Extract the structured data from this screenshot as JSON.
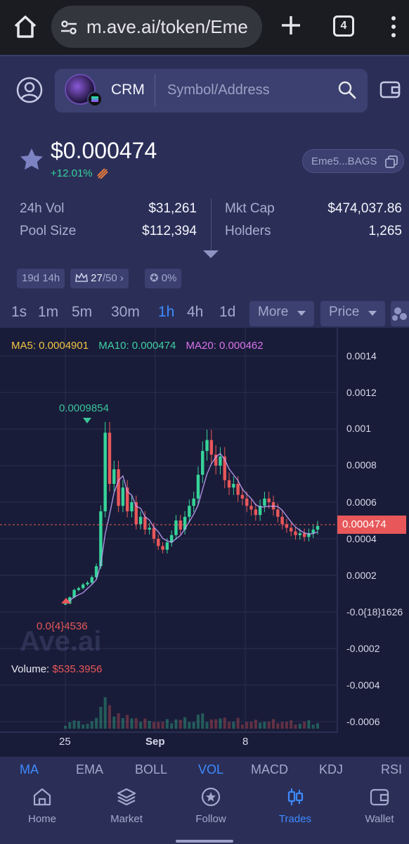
{
  "browser": {
    "url": "m.ave.ai/token/Eme",
    "tab_count": "4",
    "icons": [
      "home-icon",
      "tune-icon",
      "plus-icon",
      "tabs-icon",
      "more-vert-icon"
    ]
  },
  "header": {
    "token_symbol": "CRM",
    "search_placeholder": "Symbol/Address",
    "icons": [
      "user-icon",
      "search-icon",
      "wallet-icon"
    ]
  },
  "token": {
    "price": "$0.000474",
    "change": "+12.01%",
    "address_short": "Eme5...BAGS"
  },
  "stats": {
    "vol_label": "24h Vol",
    "vol_value": "$31,261",
    "pool_label": "Pool Size",
    "pool_value": "$112,394",
    "mcap_label": "Mkt Cap",
    "mcap_value": "$474,037.86",
    "holders_label": "Holders",
    "holders_value": "1,265"
  },
  "chips": {
    "age": "19d 14h",
    "score_num": "27",
    "score_den": "/50",
    "tax": "0%"
  },
  "timeframes": [
    "1s",
    "1m",
    "5m",
    "30m",
    "1h",
    "4h",
    "1d"
  ],
  "active_timeframe": "1h",
  "controls": {
    "more_label": "More",
    "price_label": "Price"
  },
  "chart_data": {
    "type": "candlestick",
    "ma": {
      "ma5": "MA5: 0.0004901",
      "ma10": "MA10: 0.000474",
      "ma20": "MA20: 0.000462"
    },
    "y_ticks": [
      "0.0014",
      "0.0012",
      "0.001",
      "0.0008",
      "0.0006",
      "0.0004",
      "0.0002",
      "-0.0{18}1626",
      "-0.0002",
      "-0.0004",
      "-0.0006"
    ],
    "x_ticks": [
      "25",
      "Sep",
      "8"
    ],
    "current_price": "0.000474",
    "high_label": "0.0009854",
    "low_label": "0.0{4}4536",
    "volume_label": "Volume:",
    "volume_value": "$535.3956",
    "watermark": "Ave.ai",
    "series_close": [
      4.5e-05,
      8e-05,
      0.00012,
      0.00013,
      0.00015,
      0.00016,
      0.00019,
      0.00025,
      0.00055,
      0.00098,
      0.0007,
      0.00078,
      0.00058,
      0.00068,
      0.00055,
      0.0006,
      0.00048,
      0.00052,
      0.00045,
      0.00046,
      0.0004,
      0.00036,
      0.00034,
      0.00038,
      0.00042,
      0.0005,
      0.00045,
      0.00052,
      0.00058,
      0.00062,
      0.00075,
      0.00088,
      0.00094,
      0.00086,
      0.0008,
      0.00085,
      0.00072,
      0.00068,
      0.0007,
      0.00064,
      0.00062,
      0.00058,
      0.00056,
      0.00053,
      0.00058,
      0.00062,
      0.0006,
      0.00056,
      0.00052,
      0.00048,
      0.00046,
      0.00044,
      0.00042,
      0.00043,
      0.00041,
      0.00043,
      0.00045,
      0.00047
    ]
  },
  "indicators": [
    "MA",
    "EMA",
    "BOLL",
    "VOL",
    "MACD",
    "KDJ",
    "RSI"
  ],
  "nav": {
    "home": "Home",
    "market": "Market",
    "follow": "Follow",
    "trades": "Trades",
    "wallet": "Wallet"
  },
  "colors": {
    "accent": "#3d8bff",
    "up": "#36d49a",
    "down": "#e8575a",
    "bg": "#2b2f58",
    "chart_bg": "#191c38"
  }
}
